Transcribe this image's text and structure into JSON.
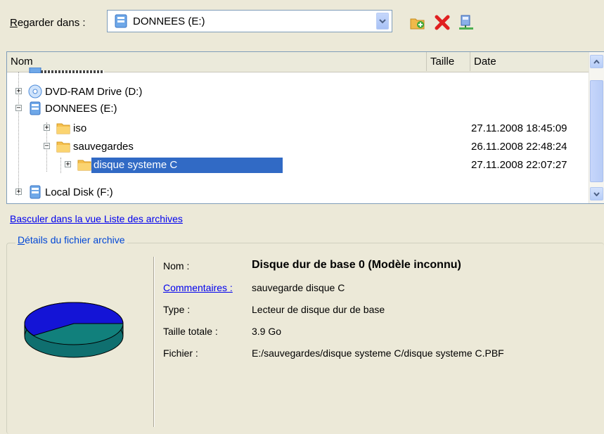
{
  "toolbar": {
    "lookin_prefix": "R",
    "lookin_rest": "egarder dans :",
    "location_value": "DONNEES (E:)",
    "new_folder_icon": "new-folder-icon",
    "delete_icon": "delete-icon",
    "network_icon": "network-drive-icon"
  },
  "columns": {
    "name": "Nom",
    "size": "Taille",
    "date": "Date"
  },
  "tree": [
    {
      "label": "DVD-RAM Drive (D:)",
      "date": ""
    },
    {
      "label": "DONNEES (E:)",
      "date": ""
    },
    {
      "label": "iso",
      "date": "27.11.2008 18:45:09"
    },
    {
      "label": "sauvegardes",
      "date": "26.11.2008 22:48:24"
    },
    {
      "label": "disque systeme C",
      "date": "27.11.2008 22:07:27"
    },
    {
      "label": "Local Disk (F:)",
      "date": ""
    }
  ],
  "switch_link": "Basculer dans la vue Liste des archives",
  "details": {
    "title_prefix": "D",
    "title_rest": "étails du fichier archive",
    "name_label": "Nom :",
    "name_value": "Disque dur de base 0 (Modèle inconnu)",
    "comments_label": "Commentaires :",
    "comments_value": "sauvegarde disque C",
    "type_label": "Type :",
    "type_value": "Lecteur de disque dur de base",
    "size_label": "Taille totale :",
    "size_value": "3.9 Go",
    "file_label": "Fichier :",
    "file_value": "E:/sauvegardes/disque systeme C/disque systeme C.PBF"
  },
  "colors": {
    "selection": "#316ac5",
    "background": "#ece9d8",
    "pie_top": "#1414d6",
    "pie_side": "#0f6f6f"
  }
}
